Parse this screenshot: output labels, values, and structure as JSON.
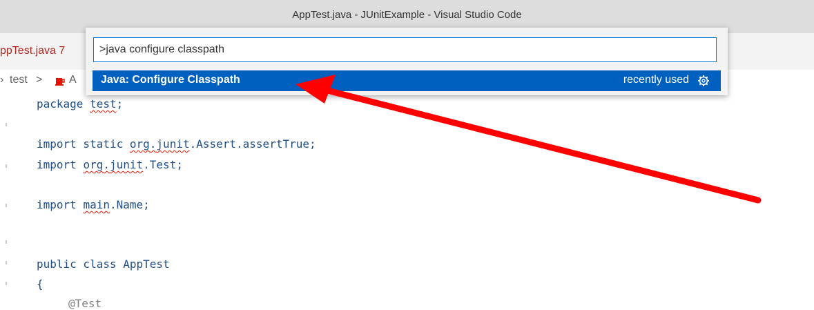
{
  "window": {
    "title": "AppTest.java - JUnitExample - Visual Studio Code"
  },
  "tab": {
    "label": "ppTest.java",
    "problem_count": "7"
  },
  "breadcrumb": {
    "part1": "test",
    "separator": ">",
    "part2": "A"
  },
  "command_palette": {
    "input_value": ">java configure classpath",
    "selected_item": {
      "label": "Java: Configure Classpath",
      "meta": "recently used",
      "icon": "gear-icon"
    }
  },
  "code": {
    "line1_keyword": "package",
    "line1_pkg": "test",
    "line1_end": ";",
    "line2_kw": "import static",
    "line2_a": "org",
    "line2_dot1": ".",
    "line2_b": "junit",
    "line2_rest": ".Assert.assertTrue;",
    "line3_kw": "import",
    "line3_a": "org",
    "line3_dot1": ".",
    "line3_b": "junit",
    "line3_rest": ".Test;",
    "line4_kw": "import",
    "line4_a": "main",
    "line4_rest": ".Name;",
    "line5": "public class AppTest",
    "line6": "{",
    "line7": "@Test"
  },
  "annotation": {
    "color": "#ff0000"
  }
}
